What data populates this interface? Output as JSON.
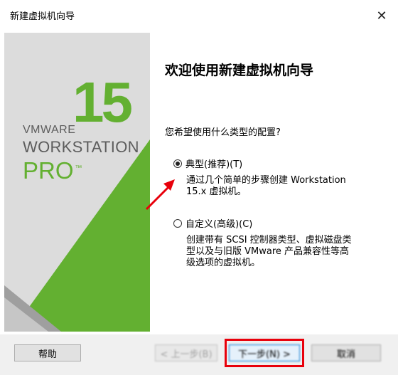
{
  "window": {
    "title": "新建虚拟机向导",
    "close_glyph": "✕"
  },
  "logo": {
    "number": "15",
    "brand": "VMWARE",
    "product": "WORKSTATION",
    "edition": "PRO",
    "tm": "™"
  },
  "content": {
    "heading": "欢迎使用新建虚拟机向导",
    "question": "您希望使用什么类型的配置?",
    "options": [
      {
        "label": "典型(推荐)(T)",
        "checked": true,
        "desc_lines": [
          "通过几个简单的步骤创建 Workstation",
          "15.x 虚拟机。"
        ]
      },
      {
        "label": "自定义(高级)(C)",
        "checked": false,
        "desc_lines": [
          "创建带有 SCSI 控制器类型、虚拟磁盘类",
          "型以及与旧版 VMware 产品兼容性等高",
          "级选项的虚拟机。"
        ]
      }
    ]
  },
  "footer": {
    "help_label": "帮助",
    "back_label": "< 上一步(B)",
    "next_label": "下一步(N) >",
    "cancel_label": "取消"
  },
  "colors": {
    "brand_green": "#63b031",
    "annotation_red": "#e8000b"
  }
}
